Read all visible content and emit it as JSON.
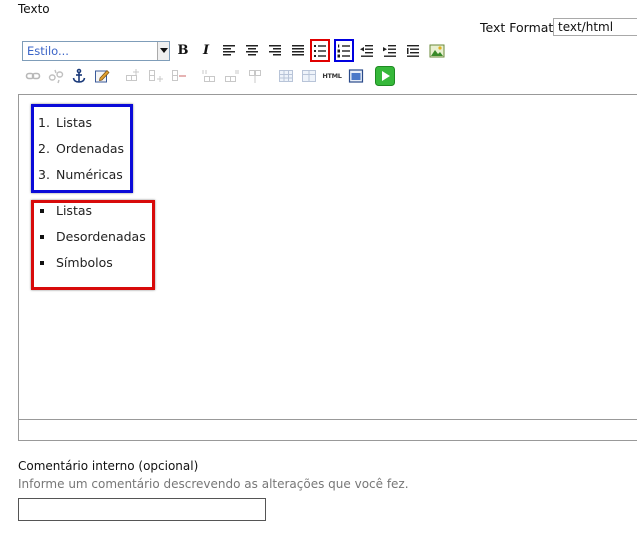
{
  "field": {
    "label": "Texto"
  },
  "text_format": {
    "label": "Text Format",
    "value": "text/html"
  },
  "toolbar": {
    "style_placeholder": "Estilo...",
    "bold_label": "B",
    "italic_label": "I",
    "html_label": "HTML"
  },
  "editor": {
    "ordered_list": [
      {
        "marker": "1.",
        "text": "Listas"
      },
      {
        "marker": "2.",
        "text": "Ordenadas"
      },
      {
        "marker": "3.",
        "text": "Numéricas"
      }
    ],
    "unordered_list": [
      {
        "text": "Listas"
      },
      {
        "text": "Desordenadas"
      },
      {
        "text": "Símbolos"
      }
    ]
  },
  "comment": {
    "label": "Comentário interno (opcional)",
    "help": "Informe um comentário descrevendo as alterações que você fez.",
    "value": ""
  },
  "colors": {
    "highlight_red": "#e00000",
    "highlight_blue": "#0000e0",
    "link_blue": "#3a64c8"
  }
}
